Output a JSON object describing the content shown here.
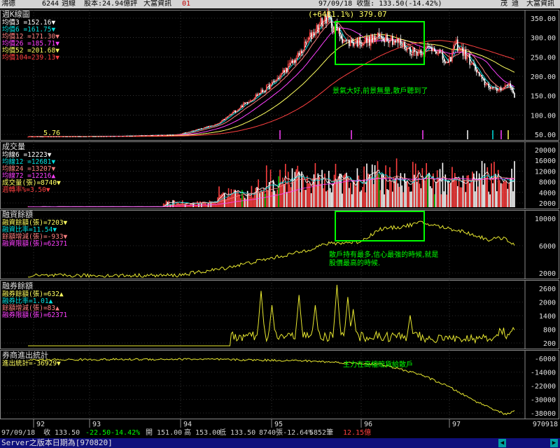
{
  "topbar": {
    "title": "鴻德 ",
    "code": "6244",
    "mode": "週線",
    "capital": "股本:24.94億評",
    "source": "大富資訊",
    "flag": "01",
    "date_close": "97/09/18 收盤: 133.50(-14.42%)",
    "name_right": "茂  迪",
    "source_right": "大富資訊"
  },
  "panels": {
    "kline": {
      "title": "週K線圖",
      "legend": [
        {
          "text": "均價3   =152.16▼",
          "color": "#ffffff"
        },
        {
          "text": "均價6   =161.75▼",
          "color": "#00e0e0"
        },
        {
          "text": "均價12 =171.30▼",
          "color": "#ff8080"
        },
        {
          "text": "均價26 =185.71▼",
          "color": "#ff40ff"
        },
        {
          "text": "均價52 =201.68▼",
          "color": "#ffff60"
        },
        {
          "text": "均價104=239.13▼",
          "color": "#ff4040"
        }
      ],
      "axis": [
        "350.00",
        "300.00",
        "250.00",
        "200.00",
        "150.00",
        "100.00",
        "50.00"
      ],
      "peak_label": "(+6481.1%) 379.07",
      "low_label": "5.76",
      "annotation": "景氣大好,前景無量,散戶聽到了"
    },
    "volume": {
      "title": "成交量",
      "legend": [
        {
          "text": "均線6   =12223▼",
          "color": "#ffffff"
        },
        {
          "text": "均線12 =12681▼",
          "color": "#00e0e0"
        },
        {
          "text": "均線24 =13207▼",
          "color": "#ff8080"
        },
        {
          "text": "均線72 =12216▲",
          "color": "#ff40ff"
        },
        {
          "text": "成交量(張)=8740▼",
          "color": "#ffff60"
        },
        {
          "text": "週轉率%=3.50▼",
          "color": "#ff4040"
        }
      ],
      "axis": [
        "20000",
        "16000",
        "12000",
        "8000",
        "4000",
        "2000"
      ]
    },
    "margin": {
      "title": "融資餘額",
      "legend": [
        {
          "text": "融資餘額(張)=7203▼",
          "color": "#ffff60"
        },
        {
          "text": "融資比率=11.54▼",
          "color": "#00e0e0"
        },
        {
          "text": "餘額增減(張)=-933▼",
          "color": "#ff8080"
        },
        {
          "text": "融資限額(張)=62371",
          "color": "#ff40ff"
        }
      ],
      "axis": [
        "10000",
        "6000",
        "2000"
      ],
      "annotation1": "散戶持有最多,信心最強的時候,就是",
      "annotation2": "股價最高的時候."
    },
    "short": {
      "title": "融券餘額",
      "legend": [
        {
          "text": "融券餘額(張)=632▲",
          "color": "#ffff60"
        },
        {
          "text": "融券比率=1.01▲",
          "color": "#00e0e0"
        },
        {
          "text": "餘額增減(張)=83▲",
          "color": "#ff8080"
        },
        {
          "text": "融券限額(張)=62371",
          "color": "#ff40ff"
        }
      ],
      "axis": [
        "2600",
        "2000",
        "1400",
        "800",
        "200"
      ]
    },
    "broker": {
      "title": "券商進出統計",
      "legend": [
        {
          "text": "進出統計=-36929▼",
          "color": "#ffff60"
        }
      ],
      "axis": [
        "-6000",
        "-14000",
        "-22000",
        "-30000",
        "-38000"
      ],
      "annotation": "主力在高檔賠貨給散戶"
    }
  },
  "xaxis": {
    "labels": [
      "92",
      "93",
      "94",
      "95",
      "96",
      "97"
    ],
    "right_label": "970918"
  },
  "status": {
    "date": "97/09/18",
    "close": "收 133.50",
    "change": "-22.50",
    "pct": "-14.42%",
    "open": "開 151.00",
    "high": "高 153.00",
    "low": "低 133.50",
    "vol": "8740張-12.64%",
    "count": "5852筆",
    "turn": "12.15億"
  },
  "cmdbar": {
    "text": "Server之版本日期為[970820]",
    "left_arrow": "◀",
    "right_arrow": "▶"
  },
  "colors": {
    "up": "#ff4040",
    "down": "#ffffff",
    "flat": "#00c000",
    "grid": "#555555",
    "highlight": "#00ff00",
    "annotation": "#00ff00",
    "ma3": "#ffffff",
    "ma6": "#00e0e0",
    "ma12": "#ff8080",
    "ma26": "#ff40ff",
    "ma52": "#ffff60",
    "ma104": "#ff4040"
  }
}
